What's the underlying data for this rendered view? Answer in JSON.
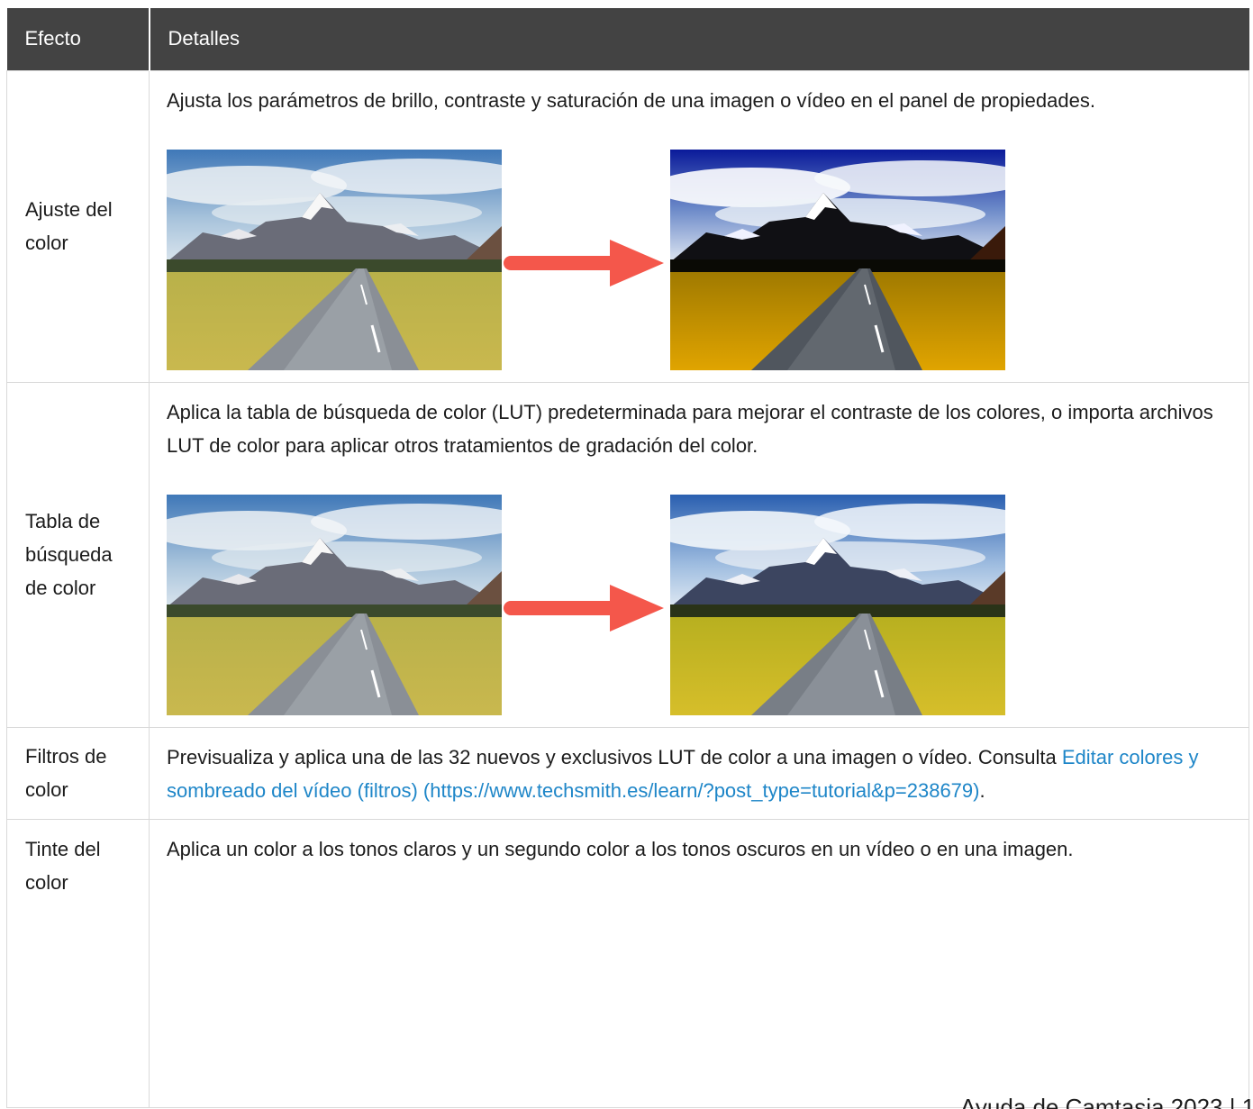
{
  "table": {
    "headers": {
      "effect": "Efecto",
      "details": "Detalles"
    },
    "rows": [
      {
        "effect": "Ajuste del color",
        "description": "Ajusta los parámetros de brillo, contraste y saturación de una imagen o vídeo en el panel de propiedades."
      },
      {
        "effect": "Tabla de búsqueda de color",
        "description": "Aplica la tabla de búsqueda de color (LUT) predeterminada para mejorar el contraste de los colores, o importa archivos LUT de color para aplicar otros tratamientos de gradación del color."
      },
      {
        "effect": "Filtros de color",
        "description_before_link": "Previsualiza y aplica una de las 32 nuevos y exclusivos LUT de color a una imagen o vídeo. Consulta ",
        "link_text": "Editar colores y sombreado del vídeo (filtros) (https://www.techsmith.es/learn/?post_type=tutorial&p=238679)",
        "description_after_link": "."
      },
      {
        "effect": "Tinte del color",
        "description": "Aplica un color a los tonos claros y un segundo color a los tonos oscuros en un vídeo o en una imagen."
      }
    ]
  },
  "footer": {
    "text": "Ayuda de Camtasia 2023 | 1"
  },
  "colors": {
    "header_bg": "#434343",
    "border": "#d9d9d9",
    "link": "#1e86c8",
    "arrow": "#f4574b"
  },
  "icons": {
    "arrow": "right-arrow-icon"
  }
}
